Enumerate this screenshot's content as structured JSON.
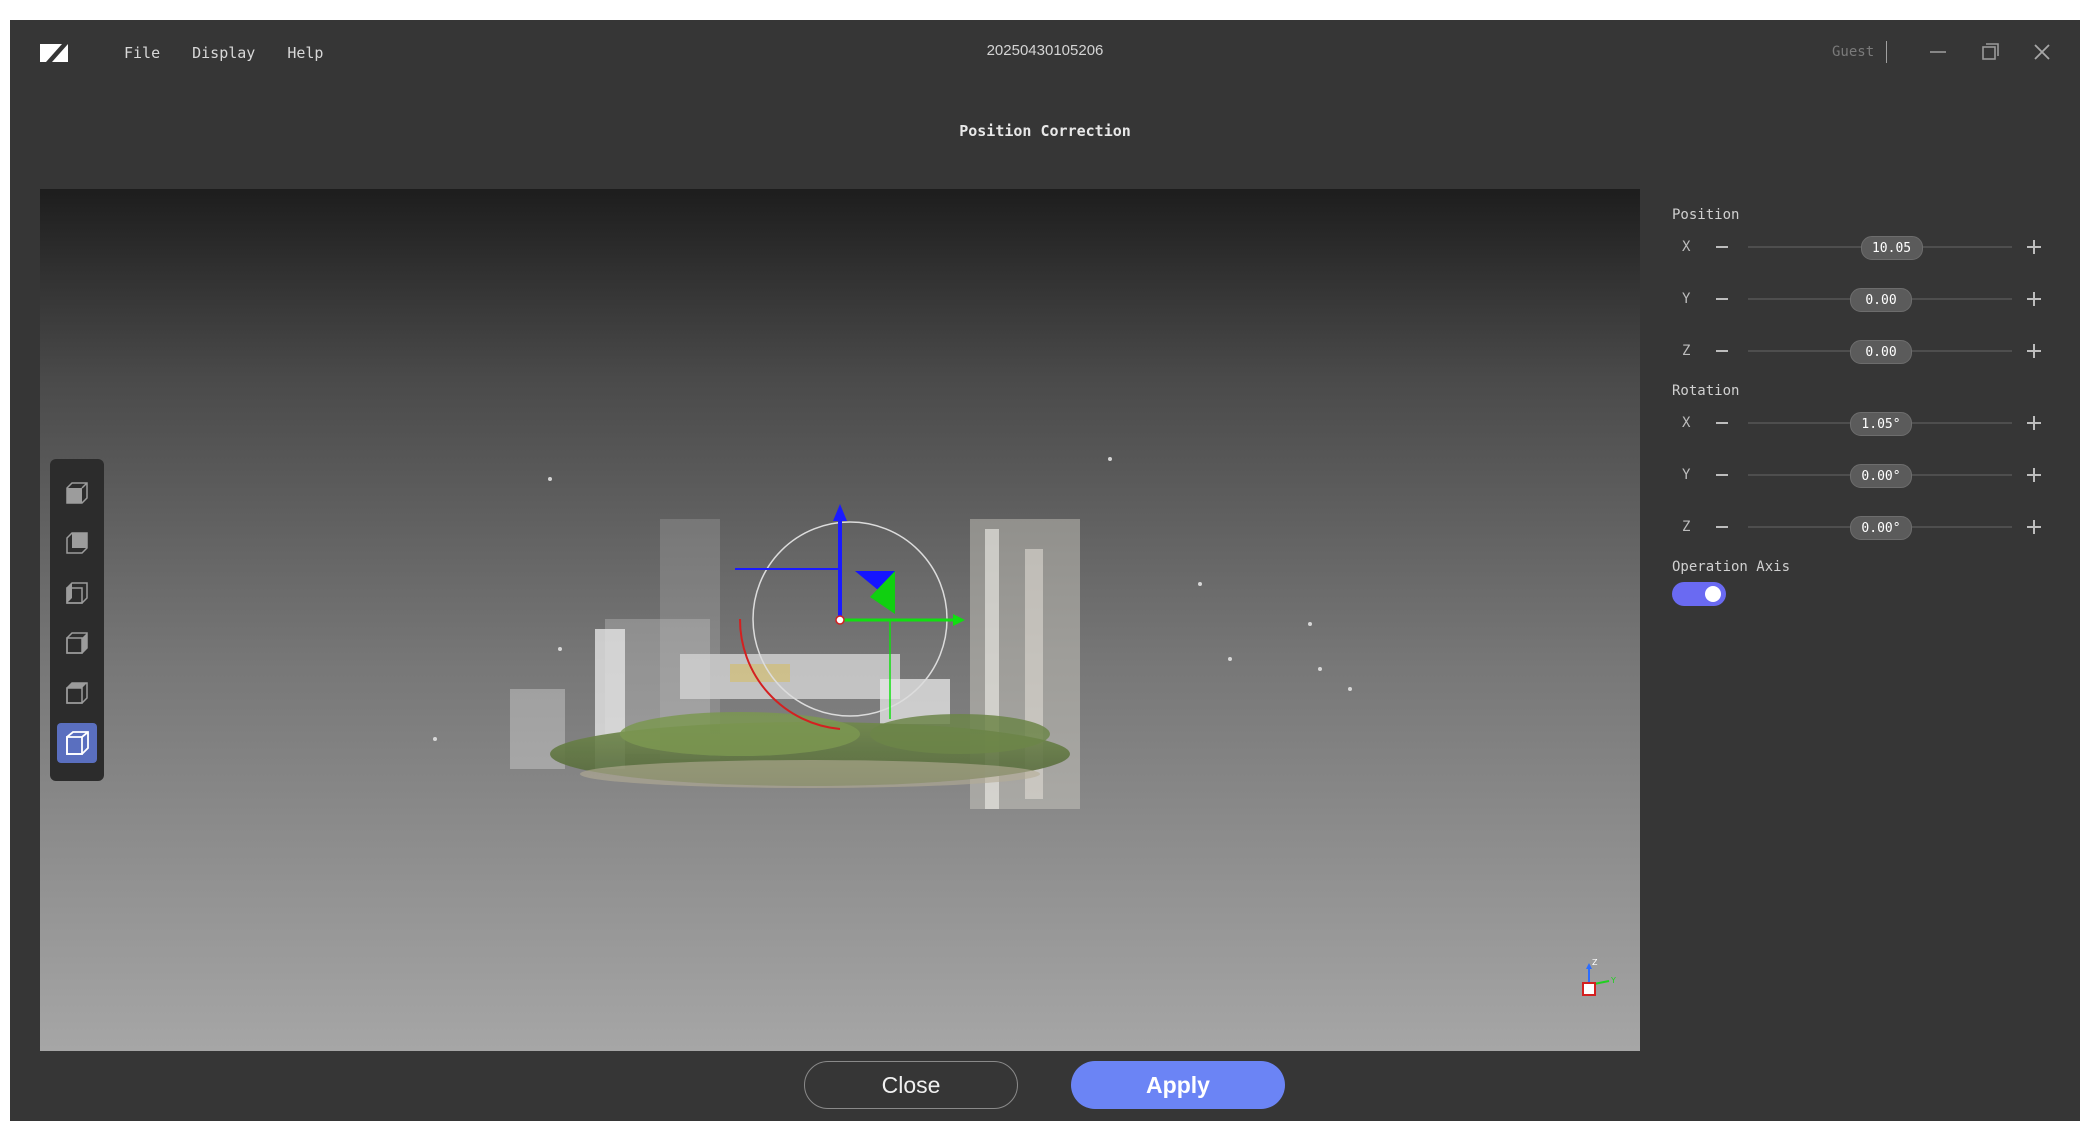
{
  "menu": [
    "File",
    "Display",
    "Help"
  ],
  "document_title": "20250430105206",
  "user": "Guest",
  "dialog_title": "Position Correction",
  "position": {
    "label": "Position",
    "axes": [
      {
        "axis": "X",
        "value": "10.05",
        "fraction": 0.54
      },
      {
        "axis": "Y",
        "value": "0.00",
        "fraction": 0.5
      },
      {
        "axis": "Z",
        "value": "0.00",
        "fraction": 0.5
      }
    ]
  },
  "rotation": {
    "label": "Rotation",
    "axes": [
      {
        "axis": "X",
        "value": "1.05°",
        "fraction": 0.5
      },
      {
        "axis": "Y",
        "value": "0.00°",
        "fraction": 0.5
      },
      {
        "axis": "Z",
        "value": "0.00°",
        "fraction": 0.5
      }
    ]
  },
  "operation_axis": {
    "label": "Operation Axis",
    "enabled": true
  },
  "buttons": {
    "close": "Close",
    "apply": "Apply"
  },
  "icons": {
    "view_buttons": [
      "view-front-icon",
      "view-back-icon",
      "view-left-icon",
      "view-right-icon",
      "view-top-icon",
      "view-perspective-icon"
    ],
    "active_view": "view-perspective-icon"
  },
  "mini_axes": {
    "z": "Z",
    "y": "Y"
  },
  "colors": {
    "accent": "#6b84f5",
    "toggle": "#6a6af2",
    "active_view": "#5a6fbf"
  }
}
